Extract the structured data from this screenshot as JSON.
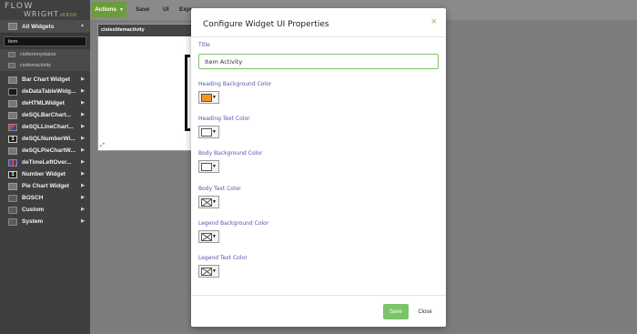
{
  "app": {
    "logo_top": "FLOW",
    "logo_bottom": "WRIGHT",
    "version": "v9.8.0.0"
  },
  "toolbar": {
    "actions_label": "Actions",
    "save_label": "Save",
    "ui_label": "UI",
    "export_label": "Expo"
  },
  "sidebar": {
    "header_label": "All Widgets",
    "search_value": "item",
    "sub_items": [
      "cisItemmystatus",
      "cisitemactivity"
    ],
    "items": [
      {
        "label": "Bar Chart Widget",
        "icon": "bar-chart-icon"
      },
      {
        "label": "deDataTableWidg...",
        "icon": "data-table-icon"
      },
      {
        "label": "deHTMLWidget",
        "icon": "html-icon"
      },
      {
        "label": "deSQLBarChart...",
        "icon": "sql-bar-chart-icon"
      },
      {
        "label": "deSQLLineChart...",
        "icon": "sql-line-chart-icon"
      },
      {
        "label": "deSQLNumberWi...",
        "icon": "sql-number-icon"
      },
      {
        "label": "deSQLPieChartW...",
        "icon": "sql-pie-chart-icon"
      },
      {
        "label": "deTimeLeftOver...",
        "icon": "time-left-icon"
      },
      {
        "label": "Number Widget",
        "icon": "number-icon"
      },
      {
        "label": "Pie Chart Widget",
        "icon": "pie-chart-icon"
      }
    ],
    "folders": [
      "BOSCH",
      "Custom",
      "System"
    ]
  },
  "canvas": {
    "widget_title": "cistestitemactivity"
  },
  "modal": {
    "title": "Configure Widget UI Properties",
    "close_icon": "×",
    "title_label": "Title",
    "title_value": "Item Activity",
    "fields": [
      {
        "label": "Heading Background Color",
        "color": "#f7931e"
      },
      {
        "label": "Heading Text Color",
        "color": "#ffffff"
      },
      {
        "label": "Body Background Color",
        "color": "#ffffff"
      },
      {
        "label": "Body Text Color",
        "color": "none"
      },
      {
        "label": "Legend Background Color",
        "color": "none"
      },
      {
        "label": "Legend Text Color",
        "color": "none"
      }
    ],
    "save_label": "Save",
    "close_label": "Close"
  },
  "colors": {
    "accent_green": "#7cc46a",
    "actions_green": "#6a9e3a",
    "label_blue": "#4f5aa8",
    "sidebar_bg": "#3f3f3f"
  }
}
